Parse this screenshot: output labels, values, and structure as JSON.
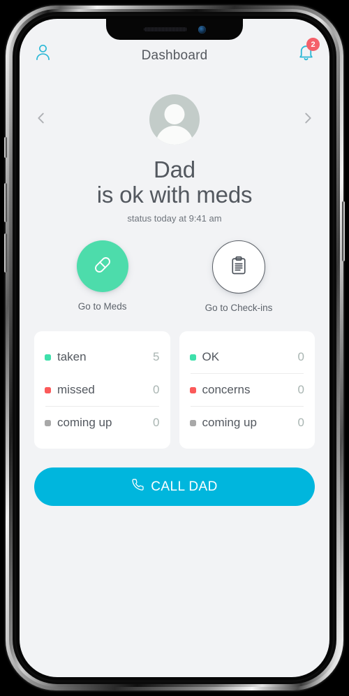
{
  "navbar": {
    "title": "Dashboard",
    "profile_icon": "person-icon",
    "notifications_icon": "bell-icon",
    "notification_count": "2"
  },
  "profile": {
    "prev_icon": "chevron-left-icon",
    "next_icon": "chevron-right-icon",
    "avatar_icon": "avatar-placeholder-icon",
    "name": "Dad",
    "status_line": "is ok with meds",
    "status_meta": "status today at 9:41 am"
  },
  "actions": [
    {
      "icon": "pill-icon",
      "label": "Go to Meds",
      "style": "filled-green"
    },
    {
      "icon": "clipboard-icon",
      "label": "Go to Check-ins",
      "style": "outlined-white"
    }
  ],
  "cards": [
    {
      "name": "meds-summary-card",
      "rows": [
        {
          "label": "taken",
          "value": "5",
          "dot": "green",
          "divider_after": false
        },
        {
          "label": "missed",
          "value": "0",
          "dot": "red",
          "divider_after": true
        },
        {
          "label": "coming up",
          "value": "0",
          "dot": "gray",
          "divider_after": false
        }
      ]
    },
    {
      "name": "checkins-summary-card",
      "rows": [
        {
          "label": "OK",
          "value": "0",
          "dot": "green",
          "divider_after": true
        },
        {
          "label": "concerns",
          "value": "0",
          "dot": "red",
          "divider_after": true
        },
        {
          "label": "coming up",
          "value": "0",
          "dot": "gray",
          "divider_after": false
        }
      ]
    }
  ],
  "call_button": {
    "label": "CALL DAD",
    "icon": "phone-icon"
  },
  "colors": {
    "accent_cyan": "#00b6dd",
    "green": "#3ee0ab",
    "red": "#fb5a5a",
    "gray": "#a8a8a8",
    "badge_red": "#f4606a",
    "screen_bg": "#f2f3f5",
    "card_bg": "#ffffff",
    "text_dark": "#53585f",
    "value_muted": "#a9b5b2"
  }
}
